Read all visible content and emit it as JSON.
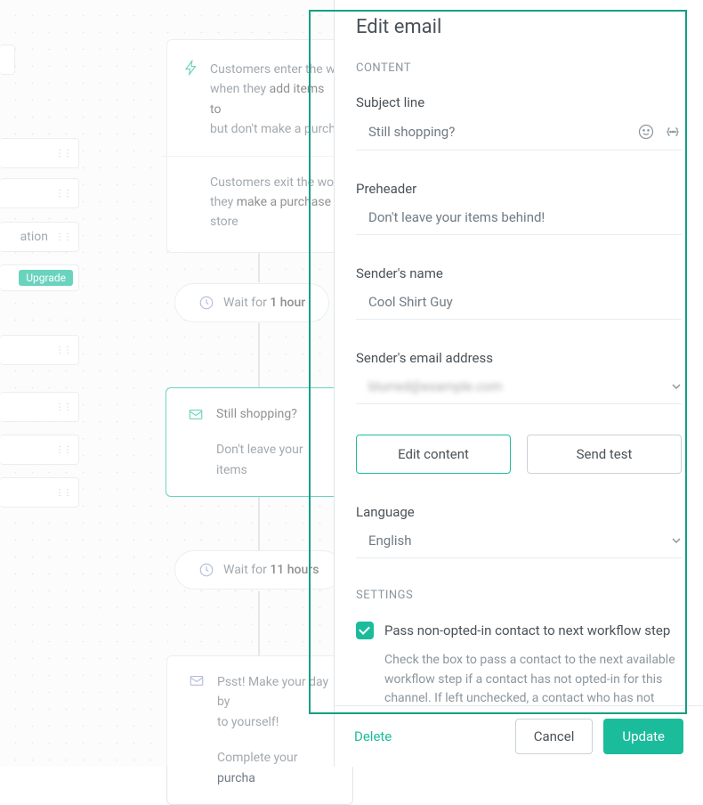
{
  "canvas": {
    "sidebar": {
      "item_ation": "ation"
    },
    "trigger": {
      "line1_a": "Customers enter the w",
      "line1_b": "when they ",
      "line1_c": "add items to",
      "line1_d": "but don't make a purch",
      "line2_a": "Customers exit the wo",
      "line2_b": "they ",
      "line2_c": "make a purchase",
      "line2_d": "store"
    },
    "wait1_a": "Wait for ",
    "wait1_b": "1 hour",
    "email1_subject": "Still shopping?",
    "email1_preview": "Don't leave your items",
    "wait2_a": "Wait for ",
    "wait2_b": "11 hours",
    "email2_subject": "Psst! Make your day by",
    "email2_sub2": "to yourself!",
    "email2_preview": "Complete your purcha",
    "upgrade": "Upgrade"
  },
  "panel": {
    "title": "Edit email",
    "content_label": "CONTENT",
    "subject_label": "Subject line",
    "subject_value": "Still shopping?",
    "preheader_label": "Preheader",
    "preheader_value": "Don't leave your items behind!",
    "sender_name_label": "Sender's name",
    "sender_name_value": "Cool Shirt Guy",
    "sender_email_label": "Sender's email address",
    "sender_email_value": "blurred@example.com",
    "edit_content_btn": "Edit content",
    "send_test_btn": "Send test",
    "language_label": "Language",
    "language_value": "English",
    "settings_label": "SETTINGS",
    "checkbox_label": "Pass non-opted-in contact to next workflow step",
    "checkbox_hint": "Check the box to pass a contact to the next available workflow step if a contact has not opted-in for this channel. If left unchecked, a contact who has not opted in",
    "delete": "Delete",
    "cancel": "Cancel",
    "update": "Update"
  }
}
